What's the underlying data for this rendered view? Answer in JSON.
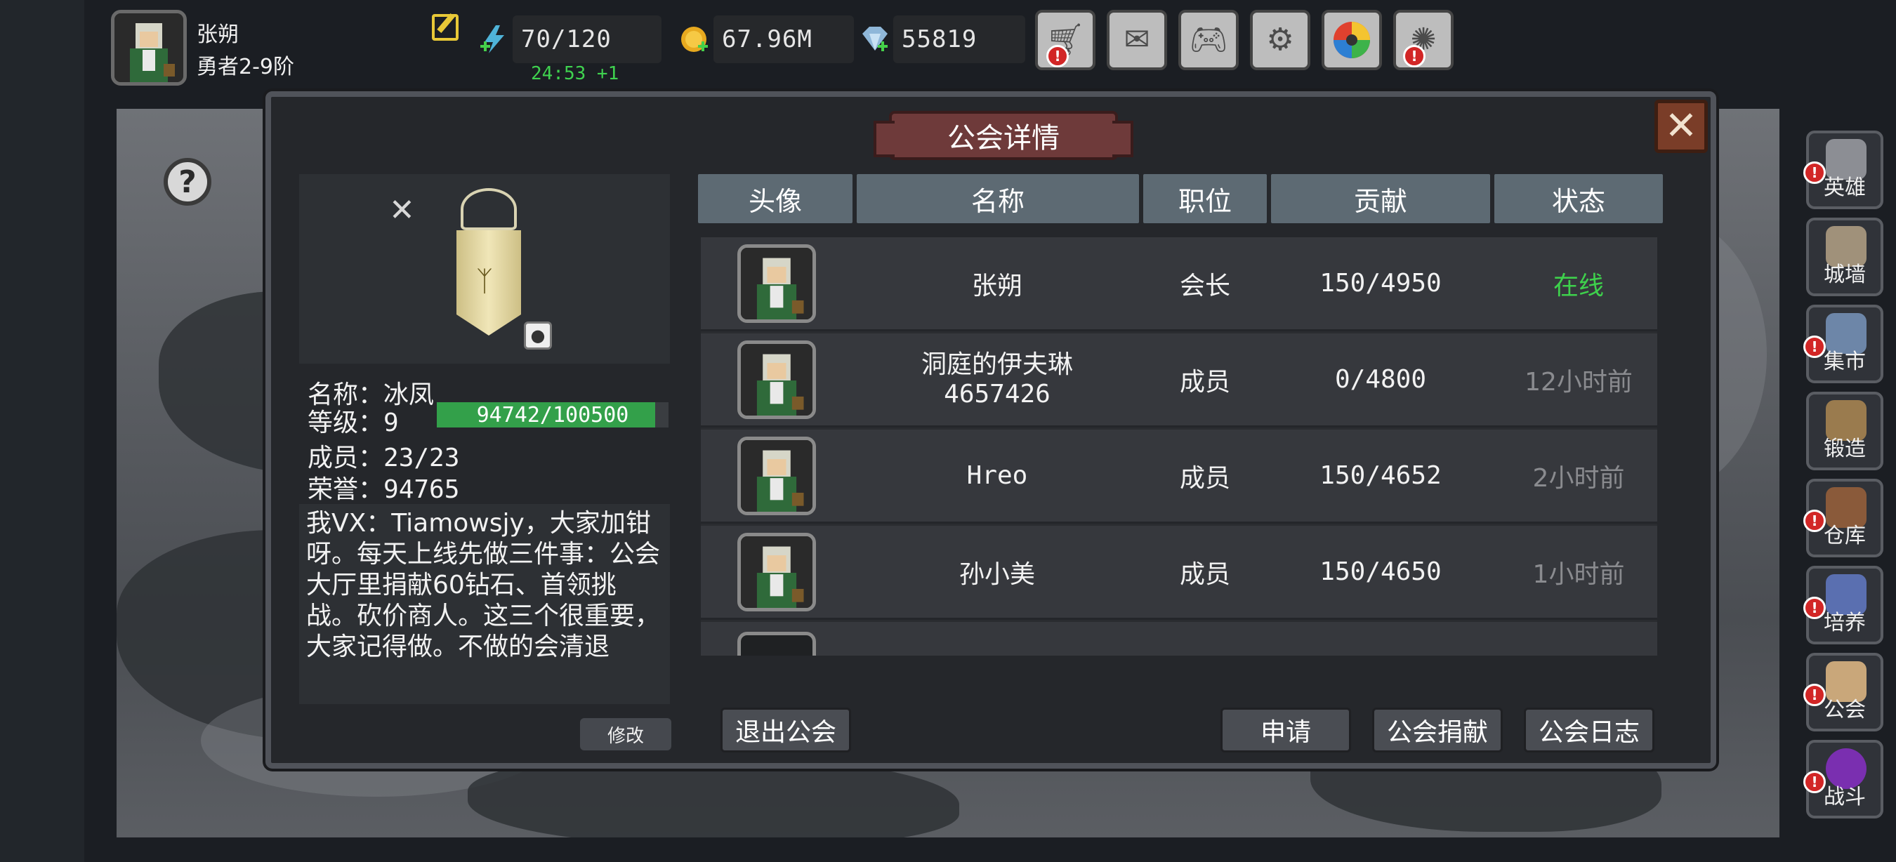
{
  "player": {
    "name": "张朔",
    "rank": "勇者2-9阶"
  },
  "resources": {
    "energy": "70/120",
    "energy_timer": "24:53 +1",
    "gold": "67.96M",
    "gems": "55819"
  },
  "top_buttons": [
    {
      "icon": "shop-cart-icon",
      "alert": true
    },
    {
      "icon": "mail-icon",
      "alert": false
    },
    {
      "icon": "gamepad-icon",
      "alert": false
    },
    {
      "icon": "settings-gear-icon",
      "alert": false
    },
    {
      "icon": "color-wheel-icon",
      "alert": false
    },
    {
      "icon": "fireworks-icon",
      "alert": true
    }
  ],
  "side_menu": [
    {
      "label": "英雄",
      "icon": "hero-helmet-icon",
      "alert": true
    },
    {
      "label": "城墙",
      "icon": "city-wall-icon",
      "alert": false
    },
    {
      "label": "集市",
      "icon": "market-stall-icon",
      "alert": true
    },
    {
      "label": "锻造",
      "icon": "anvil-icon",
      "alert": false
    },
    {
      "label": "仓库",
      "icon": "warehouse-chest-icon",
      "alert": true
    },
    {
      "label": "培养",
      "icon": "cultivate-chalice-icon",
      "alert": true
    },
    {
      "label": "公会",
      "icon": "guild-bear-icon",
      "alert": true
    },
    {
      "label": "战斗",
      "icon": "battle-portal-icon",
      "alert": true
    }
  ],
  "dialog": {
    "title": "公会详情",
    "close_icon": "close-x-icon",
    "guild": {
      "name_label": "名称：",
      "name": "冰凤",
      "level_label": "等级：",
      "level": "9",
      "exp_text": "94742/100500",
      "exp_fraction": 0.9427,
      "members_label": "成员：",
      "members": "23/23",
      "honor_label": "荣誉：",
      "honor": "94765",
      "notice": "我VX：Tiamowsjy，大家加钳呀。每天上线先做三件事：公会大厅里捐献60钻石、首领挑战。砍价商人。这三个很重要，大家记得做。不做的会清退",
      "modify_label": "修改"
    },
    "table": {
      "headers": [
        "头像",
        "名称",
        "职位",
        "贡献",
        "状态"
      ],
      "rows": [
        {
          "name": "张朔",
          "name2": "",
          "role": "会长",
          "contribution": "150/4950",
          "status": "在线",
          "online": true
        },
        {
          "name": "洞庭的伊夫琳",
          "name2": "4657426",
          "role": "成员",
          "contribution": "0/4800",
          "status": "12小时前",
          "online": false
        },
        {
          "name": "Hreo",
          "name2": "",
          "role": "成员",
          "contribution": "150/4652",
          "status": "2小时前",
          "online": false
        },
        {
          "name": "孙小美",
          "name2": "",
          "role": "成员",
          "contribution": "150/4650",
          "status": "1小时前",
          "online": false
        },
        {
          "name": "",
          "name2": "",
          "role": "",
          "contribution": "",
          "status": "",
          "online": false
        }
      ]
    },
    "buttons": {
      "leave": "退出公会",
      "apply": "申请",
      "donate": "公会捐献",
      "log": "公会日志"
    }
  }
}
